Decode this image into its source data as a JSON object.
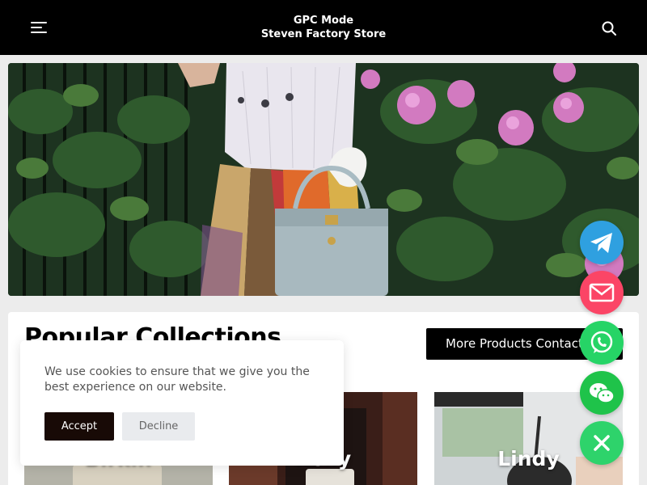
{
  "header": {
    "title_line1": "GPC Mode",
    "title_line2": "Steven Factory Store",
    "menu_icon": "hamburger-menu-icon",
    "search_icon": "search-icon"
  },
  "hero": {
    "description": ""
  },
  "collections": {
    "title": "Popular Collections",
    "more_button": "More Products Contact",
    "tiles": [
      {
        "label": "Birkin"
      },
      {
        "label": "Kelly"
      },
      {
        "label": "Lindy"
      }
    ]
  },
  "cookie": {
    "message": "We use cookies to ensure that we give you the best experience on our website.",
    "accept": "Accept",
    "decline": "Decline"
  },
  "fabs": [
    {
      "icon": "telegram-icon",
      "color": "#2fa0e0"
    },
    {
      "icon": "email-icon",
      "color": "#fb4566"
    },
    {
      "icon": "whatsapp-icon",
      "color": "#26d466"
    },
    {
      "icon": "wechat-icon",
      "color": "#1fc34a"
    },
    {
      "icon": "close-icon",
      "color": "#2ed36b"
    }
  ]
}
